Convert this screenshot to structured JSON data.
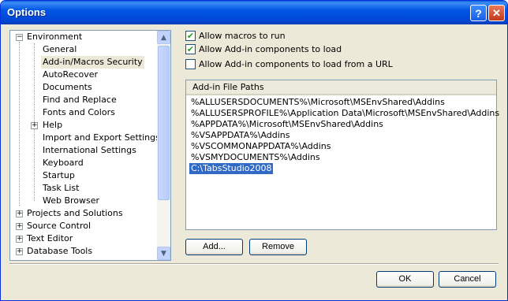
{
  "window": {
    "title": "Options",
    "help_label": "?",
    "close_label": "✕"
  },
  "tree": {
    "items": [
      {
        "label": "Environment",
        "expander": "−"
      },
      {
        "label": "General"
      },
      {
        "label": "Add-in/Macros Security"
      },
      {
        "label": "AutoRecover"
      },
      {
        "label": "Documents"
      },
      {
        "label": "Find and Replace"
      },
      {
        "label": "Fonts and Colors"
      },
      {
        "label": "Help",
        "expander": "+"
      },
      {
        "label": "Import and Export Settings"
      },
      {
        "label": "International Settings"
      },
      {
        "label": "Keyboard"
      },
      {
        "label": "Startup"
      },
      {
        "label": "Task List"
      },
      {
        "label": "Web Browser"
      },
      {
        "label": "Projects and Solutions",
        "expander": "+"
      },
      {
        "label": "Source Control",
        "expander": "+"
      },
      {
        "label": "Text Editor",
        "expander": "+"
      },
      {
        "label": "Database Tools",
        "expander": "+"
      }
    ],
    "selected": "Add-in/Macros Security",
    "scroll_up": "▲",
    "scroll_down": "▼"
  },
  "options": {
    "allow_macros": {
      "label": "Allow macros to run",
      "checked": true,
      "mark": "✔"
    },
    "allow_addins": {
      "label": "Allow Add-in components to load",
      "checked": true,
      "mark": "✔"
    },
    "allow_addins_url": {
      "label": "Allow Add-in components to load from a URL",
      "checked": false,
      "mark": ""
    }
  },
  "paths": {
    "header": "Add-in File Paths",
    "items": [
      "%ALLUSERSDOCUMENTS%\\Microsoft\\MSEnvShared\\Addins",
      "%ALLUSERSPROFILE%\\Application Data\\Microsoft\\MSEnvShared\\Addins",
      "%APPDATA%\\Microsoft\\MSEnvShared\\Addins",
      "%VSAPPDATA%\\Addins",
      "%VSCOMMONAPPDATA%\\Addins",
      "%VSMYDOCUMENTS%\\Addins",
      "C:\\TabsStudio2008"
    ],
    "selected": "C:\\TabsStudio2008"
  },
  "buttons": {
    "add": "Add...",
    "remove": "Remove",
    "ok": "OK",
    "cancel": "Cancel"
  },
  "colors": {
    "title_bar": "#0055e5",
    "selection": "#316ac5"
  }
}
